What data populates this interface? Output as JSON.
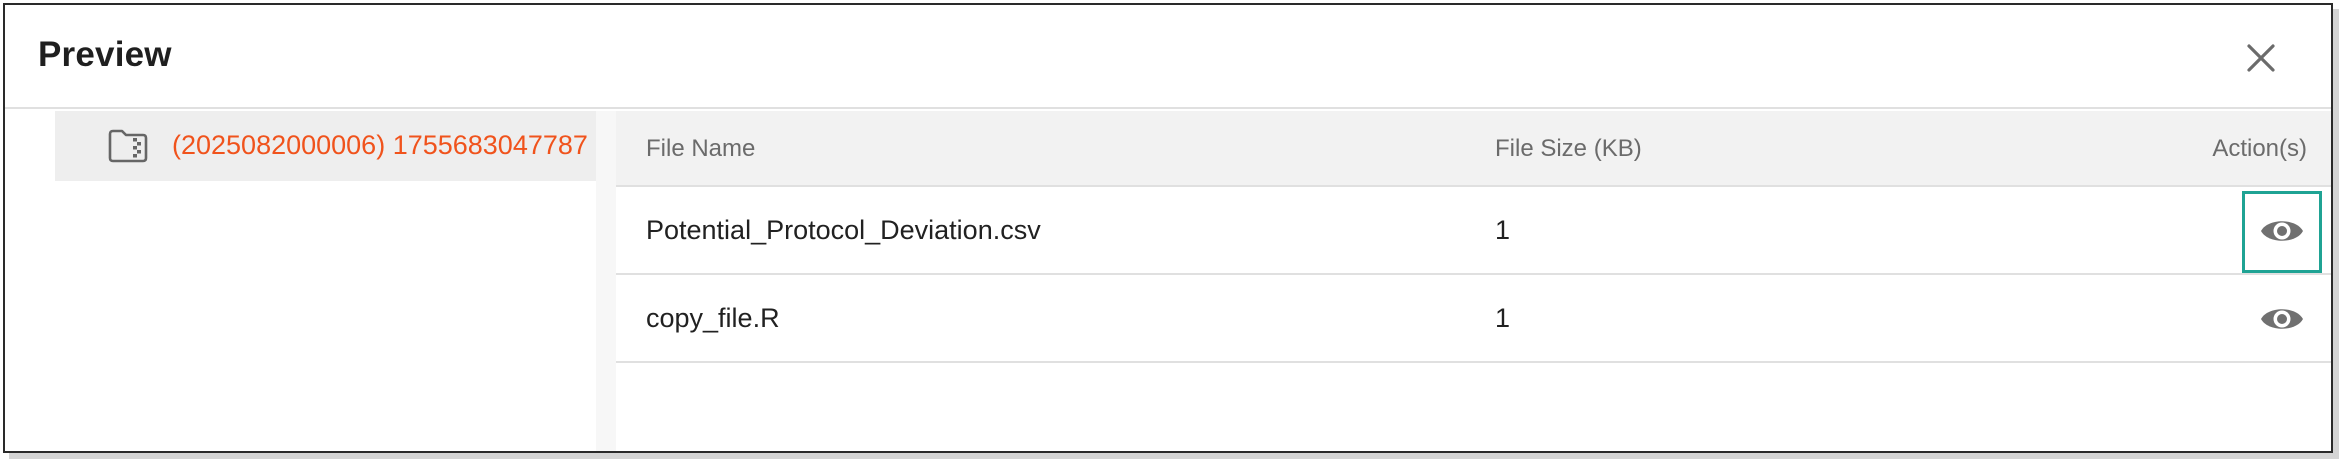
{
  "dialog": {
    "title": "Preview",
    "close_icon": "close-icon"
  },
  "folder": {
    "icon": "folder-zip-icon",
    "label": "(2025082000006) 1755683047787",
    "label_color": "#f0531c"
  },
  "table": {
    "columns": [
      "File Name",
      "File Size (KB)",
      "Action(s)"
    ],
    "rows": [
      {
        "file_name": "Potential_Protocol_Deviation.csv",
        "file_size": "1",
        "action_icon": "eye-icon",
        "highlighted": true
      },
      {
        "file_name": "copy_file.R",
        "file_size": "1",
        "action_icon": "eye-icon",
        "highlighted": false
      }
    ]
  },
  "colors": {
    "accent": "#f0531c",
    "highlight": "#1fa394",
    "icon": "#707070"
  }
}
